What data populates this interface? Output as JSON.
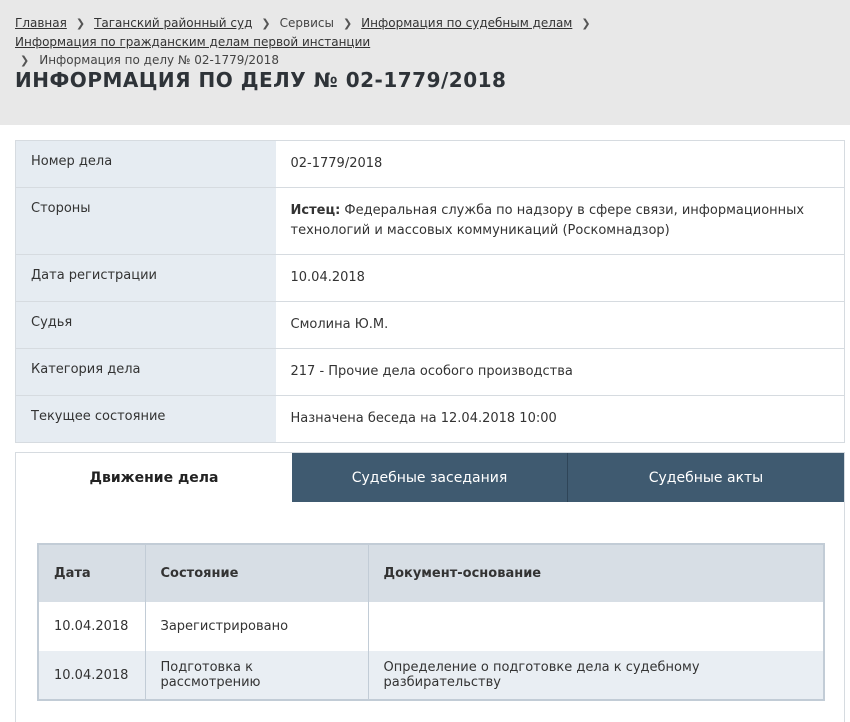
{
  "breadcrumbs": {
    "items": [
      "Главная",
      "Таганский районный суд",
      "Сервисы",
      "Информация по судебным делам",
      "Информация по гражданским делам первой инстанции"
    ],
    "current": "Информация по делу № 02-1779/2018"
  },
  "page_title": "ИНФОРМАЦИЯ ПО ДЕЛУ № 02-1779/2018",
  "case_info": [
    {
      "label": "Номер дела",
      "value": "02-1779/2018"
    },
    {
      "label": "Стороны",
      "value_prefix": "Истец:",
      "value": "Федеральная служба по надзору в сфере связи, информационных технологий и массовых коммуникаций (Роскомнадзор)"
    },
    {
      "label": "Дата регистрации",
      "value": "10.04.2018"
    },
    {
      "label": "Судья",
      "value": "Смолина Ю.М."
    },
    {
      "label": "Категория дела",
      "value": "217 - Прочие дела особого производства"
    },
    {
      "label": "Текущее состояние",
      "value": "Назначена беседа на 12.04.2018 10:00"
    }
  ],
  "tabs": [
    "Движение дела",
    "Судебные заседания",
    "Судебные акты"
  ],
  "movement": {
    "headers": [
      "Дата",
      "Состояние",
      "Документ-основание"
    ],
    "rows": [
      [
        "10.04.2018",
        "Зарегистрировано",
        ""
      ],
      [
        "10.04.2018",
        "Подготовка к рассмотрению",
        "Определение о подготовке дела к судебному разбирательству"
      ]
    ]
  },
  "colors": {
    "tab_inactive": "#3f5a70",
    "label_bg": "#e6ecf2",
    "header_bg": "#e8e8e8"
  }
}
